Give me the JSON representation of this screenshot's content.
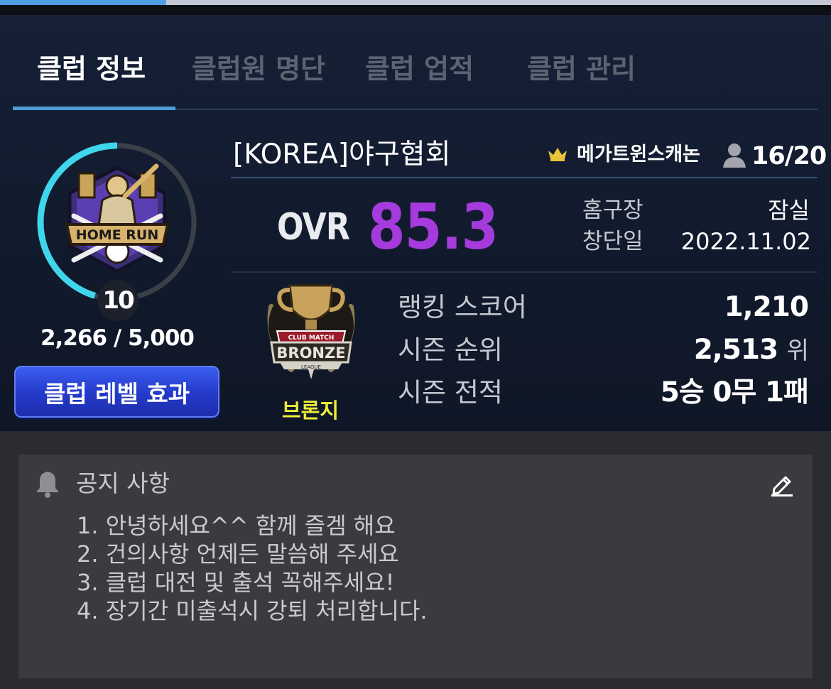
{
  "top_progress": {
    "fraction": 0.2
  },
  "tabs": [
    {
      "label": "클럽 정보",
      "active": true
    },
    {
      "label": "클럽원 명단",
      "active": false
    },
    {
      "label": "클럽 업적",
      "active": false
    },
    {
      "label": "클럽 관리",
      "active": false
    }
  ],
  "club": {
    "emblem_text": "HOME RUN",
    "level": "10",
    "exp": "2,266 / 5,000",
    "exp_fraction": 0.453,
    "level_effect_button": "클럽 레벨 효과",
    "name": "[KOREA]야구협회",
    "leader": "메가트윈스캐논",
    "members": "16/20",
    "ovr_label": "OVR",
    "ovr_value": "85.3",
    "home_label": "홈구장",
    "home_value": "잠실",
    "founded_label": "창단일",
    "founded_value": "2022.11.02"
  },
  "tier": {
    "badge_small_text": "CLUB MATCH",
    "badge_text": "BRONZE",
    "badge_sub_text": "LEAGUE",
    "name": "브론지"
  },
  "stats": {
    "ranking_label": "랭킹 스코어",
    "ranking_value": "1,210",
    "season_rank_label": "시즌 순위",
    "season_rank_value": "2,513",
    "season_rank_unit": "위",
    "season_record_label": "시즌 전적",
    "season_record_value": "5승 0무 1패"
  },
  "notice": {
    "title": "공지 사항",
    "lines": [
      "1. 안녕하세요^^ 함께 즐겜 해요",
      "2. 건의사항 언제든 말씀해 주세요",
      "3. 클럽 대전 및 출석 꼭해주세요!",
      "4. 장기간 미출석시 강퇴 처리합니다."
    ]
  },
  "colors": {
    "accent_blue": "#4d9ed8",
    "ovr_purple": "#a53bdc",
    "tier_yellow": "#ecec3c",
    "ring_cyan": "#3fd6ec",
    "button_blue": "#2a43d4"
  },
  "icons": [
    "crown-icon",
    "person-icon",
    "bell-icon",
    "edit-icon",
    "home-run-emblem",
    "bronze-trophy"
  ]
}
